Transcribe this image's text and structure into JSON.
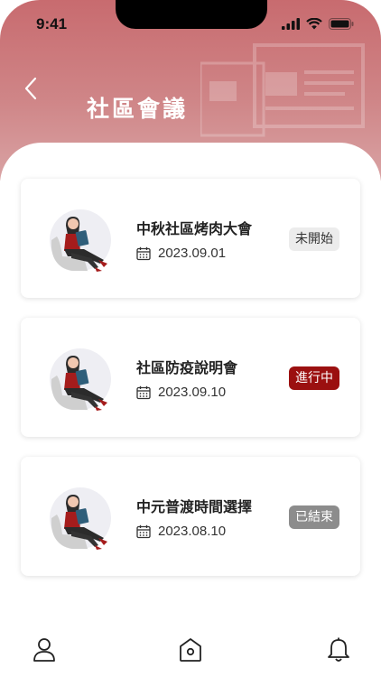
{
  "status_bar": {
    "time": "9:41"
  },
  "header": {
    "title": "社區會議"
  },
  "meetings": [
    {
      "title": "中秋社區烤肉大會",
      "date": "2023.09.01",
      "status": "未開始",
      "status_bg": "#ececec",
      "status_fg": "#333333"
    },
    {
      "title": "社區防疫說明會",
      "date": "2023.09.10",
      "status": "進行中",
      "status_bg": "#9b1010",
      "status_fg": "#ffffff"
    },
    {
      "title": "中元普渡時間選擇",
      "date": "2023.08.10",
      "status": "已結束",
      "status_bg": "#8c8c8c",
      "status_fg": "#ffffff"
    }
  ],
  "tabbar": {
    "items": [
      "user-icon",
      "home-icon",
      "bell-icon"
    ]
  },
  "colors": {
    "accent": "#9b1010",
    "header_gradient_top": "#c86b6f",
    "header_gradient_bottom": "#d9a3a4"
  }
}
